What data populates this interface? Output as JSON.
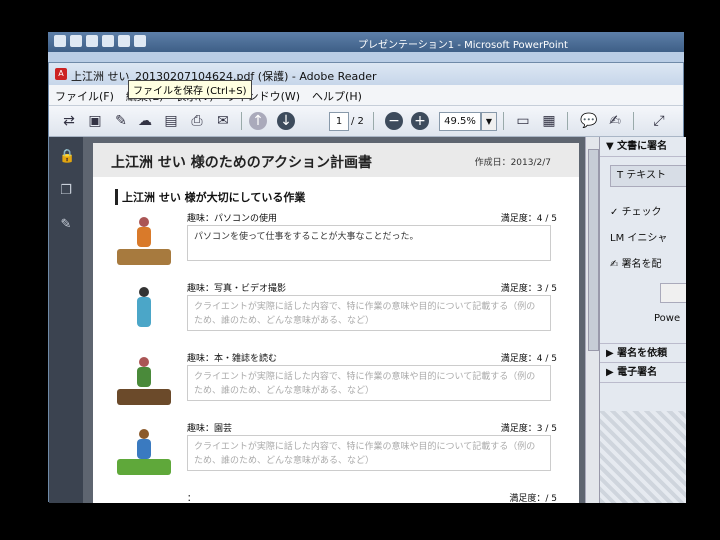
{
  "powerpoint": {
    "title": "プレゼンテーション1 - Microsoft PowerPoint"
  },
  "window": {
    "title": "上江洲 せい_20130207104624.pdf (保護) - Adobe Reader",
    "app_icon": "pdf-icon"
  },
  "menu": [
    "ファイル(F)",
    "編集(E)",
    "表示(V)",
    "ウィンドウ(W)",
    "ヘルプ(H)"
  ],
  "toolbar": {
    "page_current": "1",
    "page_total": "/ 2",
    "zoom": "49.5%"
  },
  "tooltip": "ファイルを保存 (Ctrl+S)",
  "document": {
    "title": "上江洲 せい 様のためのアクション計画書",
    "date": "作成日：2013/2/7",
    "section_title": "上江洲 せい 様が大切にしている作業",
    "items": [
      {
        "hobby": "趣味：パソコンの使用",
        "satisfaction": "満足度：4 / 5",
        "text": "パソコンを使って仕事をすることが大事なことだった。",
        "placeholder": ""
      },
      {
        "hobby": "趣味：写真・ビデオ撮影",
        "satisfaction": "満足度：3 / 5",
        "text": "",
        "placeholder": "クライエントが実際に話した内容で、特に作業の意味や目的について記載する（例のため、誰のため、どんな意味がある、など）"
      },
      {
        "hobby": "趣味：本・雑誌を読む",
        "satisfaction": "満足度：4 / 5",
        "text": "",
        "placeholder": "クライエントが実際に話した内容で、特に作業の意味や目的について記載する（例のため、誰のため、どんな意味がある、など）"
      },
      {
        "hobby": "趣味：園芸",
        "satisfaction": "満足度：3 / 5",
        "text": "",
        "placeholder": "クライエントが実際に話した内容で、特に作業の意味や目的について記載する（例のため、誰のため、どんな意味がある、など）"
      },
      {
        "hobby": "：",
        "satisfaction": "満足度：/ 5",
        "text": "",
        "placeholder": ""
      }
    ]
  },
  "right_panel": {
    "header": "文書に署名",
    "button": "テキスト",
    "rows": [
      "チェック",
      "イニシャ",
      "署名を配"
    ],
    "footer_text": "Powe",
    "sections": [
      "署名を依頼",
      "電子署名"
    ]
  }
}
